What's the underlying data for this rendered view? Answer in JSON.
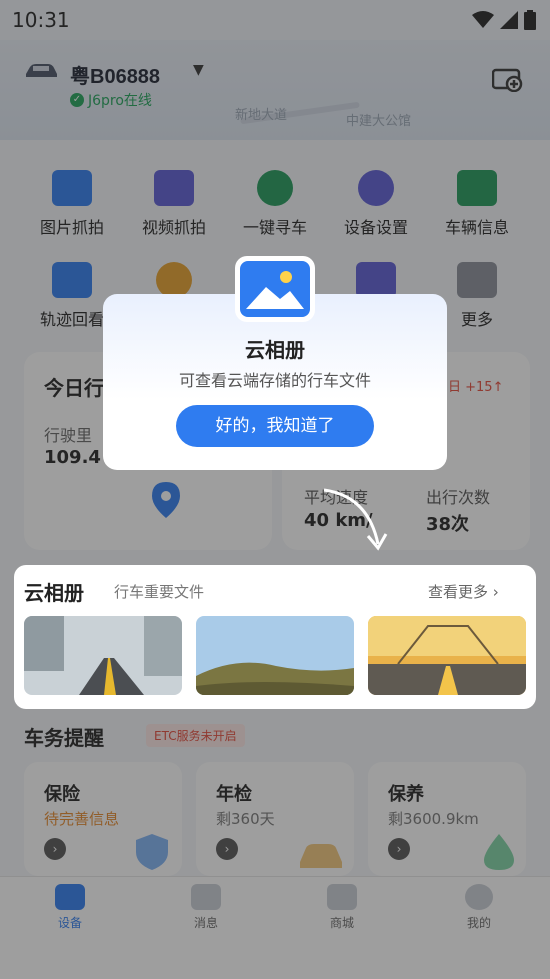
{
  "status_bar": {
    "time": "10:31"
  },
  "vehicle": {
    "plate": "粤B06888",
    "status": "J6pro在线"
  },
  "map": {
    "label_1": "新地大道",
    "label_2": "中建大公馆"
  },
  "functions": [
    {
      "label": "图片抓拍",
      "icon": "camera-icon",
      "color": "#2f7cf0"
    },
    {
      "label": "视频抓拍",
      "icon": "video-icon",
      "color": "#5b5bd6"
    },
    {
      "label": "一键寻车",
      "icon": "find-car-icon",
      "color": "#1f9a5a"
    },
    {
      "label": "设备设置",
      "icon": "gear-icon",
      "color": "#5b5bd6"
    },
    {
      "label": "车辆信息",
      "icon": "car-icon",
      "color": "#1f9a5a"
    },
    {
      "label": "轨迹回看",
      "icon": "map-track-icon",
      "color": "#2f7cf0"
    },
    {
      "label": "",
      "icon": "navigation-icon",
      "color": "#e8a12a"
    },
    {
      "label": "",
      "icon": "placeholder-icon",
      "color": "#2f7cf0"
    },
    {
      "label": "",
      "icon": "calendar-icon",
      "color": "#5b5bd6"
    },
    {
      "label": "更多",
      "icon": "grid-icon",
      "color": "#8a8f99"
    }
  ],
  "today": {
    "title": "今日行",
    "mileage_label": "行驶里",
    "mileage_value": "109.4",
    "change": "日 +15↑",
    "avg_speed_label": "平均速度",
    "avg_speed_value": "40 km/",
    "trips_label": "出行次数",
    "trips_value": "38次"
  },
  "popup": {
    "title": "云相册",
    "description": "可查看云端存储的行车文件",
    "button": "好的，我知道了"
  },
  "album": {
    "title": "云相册",
    "subtitle": "行车重要文件",
    "more": "查看更多 ›"
  },
  "reminder": {
    "title": "车务提醒",
    "etc": "ETC服务未开启",
    "cards": [
      {
        "title": "保险",
        "sub": "待完善信息",
        "sub_color": "#e8892a"
      },
      {
        "title": "年检",
        "sub": "剩360天",
        "sub_color": "#777777"
      },
      {
        "title": "保养",
        "sub": "剩3600.9km",
        "sub_color": "#777777"
      }
    ]
  },
  "nav": [
    {
      "label": "设备",
      "active": true
    },
    {
      "label": "消息",
      "active": false
    },
    {
      "label": "商城",
      "active": false
    },
    {
      "label": "我的",
      "active": false
    }
  ],
  "colors": {
    "primary": "#2f7cf0",
    "online": "#1fa45a",
    "warning": "#e54a3a"
  }
}
